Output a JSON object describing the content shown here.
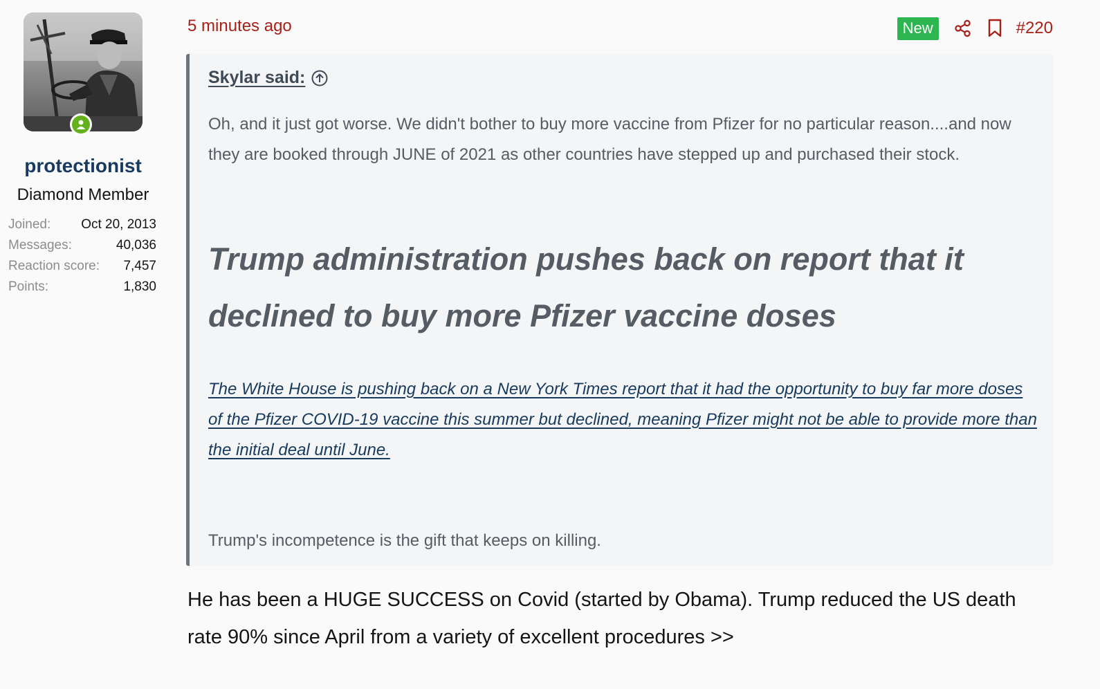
{
  "user": {
    "username": "protectionist",
    "title": "Diamond Member",
    "online": true,
    "stats": [
      {
        "label": "Joined:",
        "value": "Oct 20, 2013"
      },
      {
        "label": "Messages:",
        "value": "40,036"
      },
      {
        "label": "Reaction score:",
        "value": "7,457"
      },
      {
        "label": "Points:",
        "value": "1,830"
      }
    ]
  },
  "post": {
    "time": "5 minutes ago",
    "badge": "New",
    "number": "#220"
  },
  "quote": {
    "author": "Skylar said:",
    "paragraph1": "Oh, and it just got worse. We didn't bother to buy more vaccine from Pfizer for no particular reason....and now they are booked through JUNE of 2021 as other countries have stepped up and purchased their stock.",
    "headline": "Trump administration pushes back on report that it declined to buy more Pfizer vaccine doses",
    "link_text": "The White House is pushing back on a New York Times report that it had the opportunity to buy far more doses of the Pfizer COVID-19 vaccine this summer but declined, meaning Pfizer might not be able to provide more than the initial deal until June.",
    "paragraph2": "Trump's incompetence is the gift that keeps on killing."
  },
  "reply": {
    "text": "He has been a HUGE SUCCESS on Covid (started by Obama). Trump reduced the US death rate 90% since April from a variety of excellent procedures >>"
  },
  "icons": {
    "share": "share-icon",
    "bookmark": "bookmark-icon",
    "jump": "circle-arrow-up-icon",
    "online": "user-online-icon"
  },
  "colors": {
    "accent_red": "#a81f16",
    "username_blue": "#173a5e",
    "new_badge_green": "#2db551",
    "online_green": "#63b21b",
    "quote_border": "#6b7580",
    "quote_background": "#f4f5f6"
  }
}
